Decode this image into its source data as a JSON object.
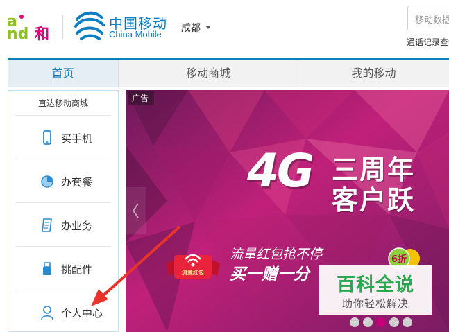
{
  "header": {
    "and_logo_text": "and和",
    "brand_cn": "中国移动",
    "brand_en": "China Mobile",
    "city": "成都",
    "search_placeholder": "移动数据",
    "quick_link": "通话记录查询"
  },
  "nav": {
    "tabs": [
      {
        "label": "首页",
        "active": true
      },
      {
        "label": "移动商城",
        "active": false
      },
      {
        "label": "我的移动",
        "active": false
      }
    ]
  },
  "sidebar": {
    "title": "直达移动商城",
    "items": [
      {
        "label": "买手机",
        "icon": "phone-icon"
      },
      {
        "label": "办套餐",
        "icon": "pie-chart-icon"
      },
      {
        "label": "办业务",
        "icon": "document-icon"
      },
      {
        "label": "挑配件",
        "icon": "usb-drive-icon"
      },
      {
        "label": "个人中心",
        "icon": "user-icon"
      }
    ]
  },
  "banner": {
    "ad_tag": "广告",
    "big_4g": "4G",
    "headline_1": "三周年",
    "headline_2": "客户跃",
    "sub_1": "流量红包抢不停",
    "sub_2": "买一赠一分",
    "redpacket_label": "流量红包",
    "discount_label": "6折",
    "slides": 5,
    "active_slide": 3
  },
  "watermark": {
    "title": "百科全说",
    "subtitle": "助你轻松解决"
  },
  "colors": {
    "brand_blue": "#0c7ec2",
    "and_green": "#8dc21f",
    "and_pink": "#e4007f",
    "banner_magenta": "#b0196e",
    "watermark_green": "#2aa84e",
    "annotation_red": "#e8342b"
  }
}
